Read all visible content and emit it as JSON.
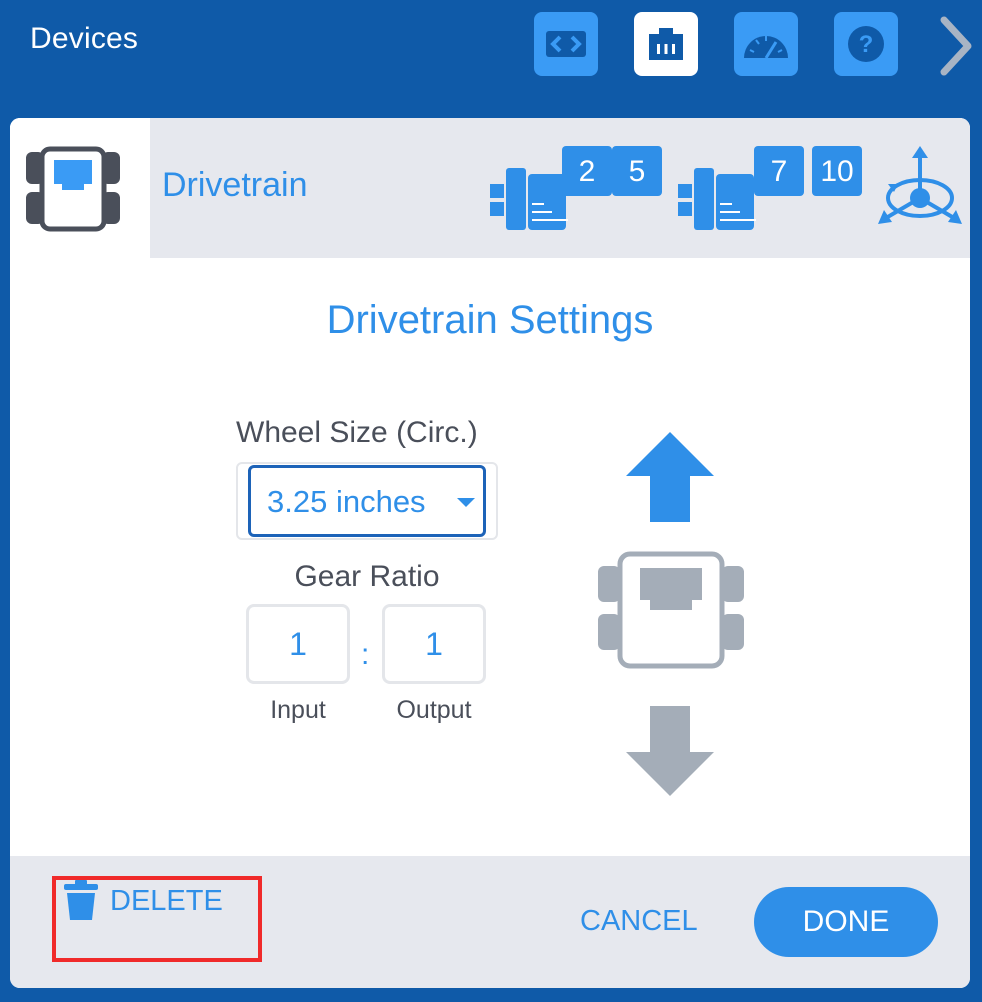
{
  "topbar": {
    "title": "Devices",
    "buttons": [
      {
        "icon": "code-icon",
        "active": false
      },
      {
        "icon": "ethernet-port-icon",
        "active": true
      },
      {
        "icon": "dashboard-gauge-icon",
        "active": false
      },
      {
        "icon": "help-icon",
        "active": false
      }
    ],
    "next_icon": "chevron-right-icon"
  },
  "device": {
    "icon": "drivetrain-robot-icon",
    "name": "Drivetrain",
    "motor_groups": [
      {
        "icon": "motor-icon",
        "ports": [
          "2",
          "5"
        ]
      },
      {
        "icon": "motor-icon",
        "ports": [
          "7",
          "10"
        ]
      }
    ],
    "extra_icon": "gyro-axes-icon"
  },
  "settings": {
    "title": "Drivetrain Settings",
    "wheel_size_label": "Wheel Size (Circ.)",
    "wheel_size_value": "3.25 inches",
    "gear_ratio_label": "Gear Ratio",
    "gear_input": "1",
    "gear_output": "1",
    "gear_separator": ":",
    "input_caption": "Input",
    "output_caption": "Output"
  },
  "preview": {
    "up_icon": "arrow-up-icon",
    "robot_icon": "robot-top-view-icon",
    "down_icon": "arrow-down-icon"
  },
  "footer": {
    "delete_label": "DELETE",
    "cancel_label": "CANCEL",
    "done_label": "DONE"
  },
  "colors": {
    "topbar_bg": "#0f5aa8",
    "accent": "#2f8fe8",
    "highlight": "#f02a2a",
    "muted_gray": "#a4adb8"
  }
}
